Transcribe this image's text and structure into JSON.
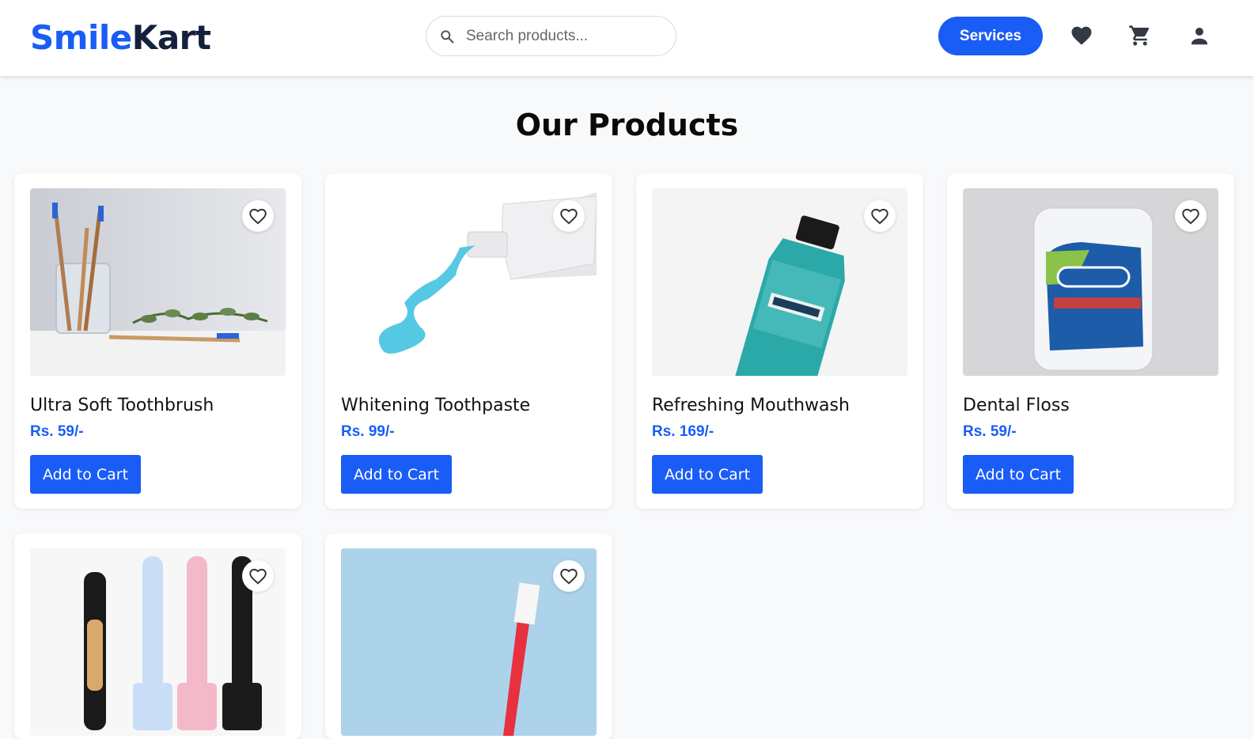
{
  "brand": {
    "part1": "Smile",
    "part2": "Kart",
    "colors": {
      "primary": "#1a5cf6",
      "dark": "#14213d"
    }
  },
  "search": {
    "placeholder": "Search products...",
    "value": ""
  },
  "nav": {
    "services_label": "Services",
    "icons": [
      "heart-icon",
      "cart-icon",
      "user-icon"
    ]
  },
  "main": {
    "title": "Our Products"
  },
  "products": [
    {
      "name": "Ultra Soft Toothbrush",
      "price": "Rs. 59/-",
      "button": "Add to Cart",
      "image": "bamboo-toothbrushes-in-jar"
    },
    {
      "name": "Whitening Toothpaste",
      "price": "Rs. 99/-",
      "button": "Add to Cart",
      "image": "toothpaste-tube-blue-gel"
    },
    {
      "name": "Refreshing Mouthwash",
      "price": "Rs. 169/-",
      "button": "Add to Cart",
      "image": "mouthwash-bottle"
    },
    {
      "name": "Dental Floss",
      "price": "Rs. 59/-",
      "button": "Add to Cart",
      "image": "floss-container"
    },
    {
      "image": "electric-toothbrushes"
    },
    {
      "image": "red-toothbrush-blue-background"
    }
  ]
}
